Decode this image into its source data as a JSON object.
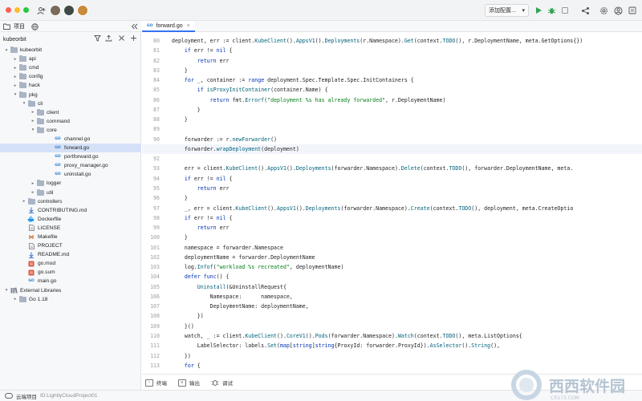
{
  "toolbar": {
    "run_config_label": "添加配置...",
    "run_config_caret": "▾",
    "icons": [
      "add-user-icon",
      "run-icon",
      "debug-icon",
      "stop-icon",
      "share-icon",
      "settings-icon",
      "account-icon"
    ]
  },
  "sidebar": {
    "tabs": [
      {
        "label": "项目",
        "icon": "project-icon"
      },
      {
        "label": "",
        "icon": "globe-icon"
      }
    ],
    "collapse_icon": "collapse-panel-icon",
    "project_label": "kubeorbit",
    "tools": [
      "filter-icon",
      "upload-icon",
      "close-icon",
      "add-icon"
    ],
    "tree": [
      {
        "label": "kubeorbit",
        "type": "folder",
        "depth": 0,
        "expanded": true
      },
      {
        "label": "api",
        "type": "folder",
        "depth": 1,
        "expanded": false
      },
      {
        "label": "cmd",
        "type": "folder",
        "depth": 1,
        "expanded": false
      },
      {
        "label": "config",
        "type": "folder",
        "depth": 1,
        "expanded": false
      },
      {
        "label": "hack",
        "type": "folder",
        "depth": 1,
        "expanded": false
      },
      {
        "label": "pkg",
        "type": "folder",
        "depth": 1,
        "expanded": true
      },
      {
        "label": "cli",
        "type": "folder",
        "depth": 2,
        "expanded": true
      },
      {
        "label": "client",
        "type": "folder",
        "depth": 3,
        "expanded": false
      },
      {
        "label": "command",
        "type": "folder",
        "depth": 3,
        "expanded": false
      },
      {
        "label": "core",
        "type": "folder",
        "depth": 3,
        "expanded": true
      },
      {
        "label": "channel.go",
        "type": "go",
        "depth": 5
      },
      {
        "label": "forward.go",
        "type": "go",
        "depth": 5,
        "selected": true
      },
      {
        "label": "portforward.go",
        "type": "go",
        "depth": 5
      },
      {
        "label": "proxy_manager.go",
        "type": "go",
        "depth": 5
      },
      {
        "label": "uninstall.go",
        "type": "go",
        "depth": 5
      },
      {
        "label": "logger",
        "type": "folder",
        "depth": 3,
        "expanded": false
      },
      {
        "label": "util",
        "type": "folder",
        "depth": 3,
        "expanded": false
      },
      {
        "label": "controllers",
        "type": "folder",
        "depth": 2,
        "expanded": false
      },
      {
        "label": "CONTRIBUTING.md",
        "type": "md",
        "depth": 2
      },
      {
        "label": "Dockerfile",
        "type": "docker",
        "depth": 2
      },
      {
        "label": "LICENSE",
        "type": "text",
        "depth": 2
      },
      {
        "label": "Makefile",
        "type": "make",
        "depth": 2
      },
      {
        "label": "PROJECT",
        "type": "text",
        "depth": 2
      },
      {
        "label": "README.md",
        "type": "md",
        "depth": 2
      },
      {
        "label": "go.mod",
        "type": "mod",
        "depth": 2
      },
      {
        "label": "go.sum",
        "type": "mod",
        "depth": 2
      },
      {
        "label": "main.go",
        "type": "go",
        "depth": 2
      },
      {
        "label": "External Libraries",
        "type": "lib",
        "depth": 0,
        "expanded": true
      },
      {
        "label": "Go 1.18",
        "type": "folder",
        "depth": 1,
        "expanded": false
      }
    ]
  },
  "editor": {
    "tab_label": "forward.go",
    "tab_close": "×",
    "current_line": 91,
    "lines": [
      {
        "n": 80,
        "parts": [
          [
            "",
            "deployment, err := client."
          ],
          [
            "fn",
            "KubeClient"
          ],
          [
            "",
            "()."
          ],
          [
            "fn",
            "AppsV1"
          ],
          [
            "",
            "()."
          ],
          [
            "fn",
            "Deployments"
          ],
          [
            "",
            "(r.Namespace)."
          ],
          [
            "fn",
            "Get"
          ],
          [
            "",
            "(context."
          ],
          [
            "fn",
            "TODO"
          ],
          [
            "",
            "(), r.DeploymentName, meta.GetOptions{})"
          ]
        ]
      },
      {
        "n": 81,
        "parts": [
          [
            "",
            "    "
          ],
          [
            "kw",
            "if"
          ],
          [
            "",
            " err != "
          ],
          [
            "kw",
            "nil"
          ],
          [
            "",
            " {"
          ]
        ]
      },
      {
        "n": 82,
        "parts": [
          [
            "",
            "        "
          ],
          [
            "kw",
            "return"
          ],
          [
            "",
            " err"
          ]
        ]
      },
      {
        "n": 83,
        "parts": [
          [
            "",
            "    }"
          ]
        ]
      },
      {
        "n": 84,
        "parts": [
          [
            "",
            "    "
          ],
          [
            "kw",
            "for"
          ],
          [
            "",
            " _, container := "
          ],
          [
            "kw",
            "range"
          ],
          [
            "",
            " deployment.Spec.Template.Spec.InitContainers {"
          ]
        ]
      },
      {
        "n": 85,
        "parts": [
          [
            "",
            "        "
          ],
          [
            "kw",
            "if"
          ],
          [
            "",
            " "
          ],
          [
            "fn",
            "isProxyInitContainer"
          ],
          [
            "",
            "(container.Name) {"
          ]
        ]
      },
      {
        "n": 86,
        "parts": [
          [
            "",
            "            "
          ],
          [
            "kw",
            "return"
          ],
          [
            "",
            " fmt."
          ],
          [
            "fn",
            "Errorf"
          ],
          [
            "",
            "("
          ],
          [
            "str",
            "\"deployment %s has already forwarded\""
          ],
          [
            "",
            ", r.DeploymentName)"
          ]
        ]
      },
      {
        "n": 87,
        "parts": [
          [
            "",
            "        }"
          ]
        ]
      },
      {
        "n": 88,
        "parts": [
          [
            "",
            "    }"
          ]
        ]
      },
      {
        "n": 89,
        "parts": [
          [
            "",
            ""
          ]
        ]
      },
      {
        "n": 90,
        "parts": [
          [
            "",
            "    forwarder := r."
          ],
          [
            "fn",
            "newForwarder"
          ],
          [
            "",
            "()"
          ]
        ]
      },
      {
        "n": 91,
        "parts": [
          [
            "",
            "    forwarder."
          ],
          [
            "fn",
            "wrapDeployment"
          ],
          [
            "",
            "(deployment)"
          ]
        ]
      },
      {
        "n": 92,
        "parts": [
          [
            "",
            ""
          ]
        ]
      },
      {
        "n": 93,
        "parts": [
          [
            "",
            "    err = client."
          ],
          [
            "fn",
            "KubeClient"
          ],
          [
            "",
            "()."
          ],
          [
            "fn",
            "AppsV1"
          ],
          [
            "",
            "()."
          ],
          [
            "fn",
            "Deployments"
          ],
          [
            "",
            "(forwarder.Namespace)."
          ],
          [
            "fn",
            "Delete"
          ],
          [
            "",
            "(context."
          ],
          [
            "fn",
            "TODO"
          ],
          [
            "",
            "(), forwarder.DeploymentName, meta."
          ]
        ]
      },
      {
        "n": 94,
        "parts": [
          [
            "",
            "    "
          ],
          [
            "kw",
            "if"
          ],
          [
            "",
            " err != "
          ],
          [
            "kw",
            "nil"
          ],
          [
            "",
            " {"
          ]
        ]
      },
      {
        "n": 95,
        "parts": [
          [
            "",
            "        "
          ],
          [
            "kw",
            "return"
          ],
          [
            "",
            " err"
          ]
        ]
      },
      {
        "n": 96,
        "parts": [
          [
            "",
            "    }"
          ]
        ]
      },
      {
        "n": 97,
        "parts": [
          [
            "",
            "    _, err = client."
          ],
          [
            "fn",
            "KubeClient"
          ],
          [
            "",
            "()."
          ],
          [
            "fn",
            "AppsV1"
          ],
          [
            "",
            "()."
          ],
          [
            "fn",
            "Deployments"
          ],
          [
            "",
            "(forwarder.Namespace)."
          ],
          [
            "fn",
            "Create"
          ],
          [
            "",
            "(context."
          ],
          [
            "fn",
            "TODO"
          ],
          [
            "",
            "(), deployment, meta.CreateOptio"
          ]
        ]
      },
      {
        "n": 98,
        "parts": [
          [
            "",
            "    "
          ],
          [
            "kw",
            "if"
          ],
          [
            "",
            " err != "
          ],
          [
            "kw",
            "nil"
          ],
          [
            "",
            " {"
          ]
        ]
      },
      {
        "n": 99,
        "parts": [
          [
            "",
            "        "
          ],
          [
            "kw",
            "return"
          ],
          [
            "",
            " err"
          ]
        ]
      },
      {
        "n": 100,
        "parts": [
          [
            "",
            "    }"
          ]
        ]
      },
      {
        "n": 101,
        "parts": [
          [
            "",
            "    namespace = forwarder.Namespace"
          ]
        ]
      },
      {
        "n": 102,
        "parts": [
          [
            "",
            "    deploymentName = forwarder.DeploymentName"
          ]
        ]
      },
      {
        "n": 103,
        "parts": [
          [
            "",
            "    log."
          ],
          [
            "fn",
            "Infof"
          ],
          [
            "",
            "("
          ],
          [
            "str",
            "\"workload %s recreated\""
          ],
          [
            "",
            ", deploymentName)"
          ]
        ]
      },
      {
        "n": 104,
        "parts": [
          [
            "",
            "    "
          ],
          [
            "kw",
            "defer"
          ],
          [
            "",
            " "
          ],
          [
            "kw",
            "func"
          ],
          [
            "",
            "() {"
          ]
        ]
      },
      {
        "n": 105,
        "parts": [
          [
            "",
            "        "
          ],
          [
            "fn",
            "Uninstall"
          ],
          [
            "",
            "(&UninstallRequest{"
          ]
        ]
      },
      {
        "n": 106,
        "parts": [
          [
            "",
            "            Namespace:      namespace,"
          ]
        ]
      },
      {
        "n": 107,
        "parts": [
          [
            "",
            "            DeploymentName: deploymentName,"
          ]
        ]
      },
      {
        "n": 108,
        "parts": [
          [
            "",
            "        })"
          ]
        ]
      },
      {
        "n": 109,
        "parts": [
          [
            "",
            "    }()"
          ]
        ]
      },
      {
        "n": 110,
        "parts": [
          [
            "",
            "    watch, _ := client."
          ],
          [
            "fn",
            "KubeClient"
          ],
          [
            "",
            "()."
          ],
          [
            "fn",
            "CoreV1"
          ],
          [
            "",
            "()."
          ],
          [
            "fn",
            "Pods"
          ],
          [
            "",
            "(forwarder.Namespace)."
          ],
          [
            "fn",
            "Watch"
          ],
          [
            "",
            "(context."
          ],
          [
            "fn",
            "TODO"
          ],
          [
            "",
            "(), meta.ListOptions{"
          ]
        ]
      },
      {
        "n": 111,
        "parts": [
          [
            "",
            "        LabelSelector: labels."
          ],
          [
            "fn",
            "Set"
          ],
          [
            "",
            "("
          ],
          [
            "kw",
            "map"
          ],
          [
            "",
            "["
          ],
          [
            "kw",
            "string"
          ],
          [
            "",
            "]"
          ],
          [
            "kw",
            "string"
          ],
          [
            "",
            "{ProxyId: forwarder.ProxyId})."
          ],
          [
            "fn",
            "AsSelector"
          ],
          [
            "",
            "()."
          ],
          [
            "fn",
            "String"
          ],
          [
            "",
            "(),"
          ]
        ]
      },
      {
        "n": 112,
        "parts": [
          [
            "",
            "    })"
          ]
        ]
      },
      {
        "n": 113,
        "parts": [
          [
            "",
            "    "
          ],
          [
            "kw",
            "for"
          ],
          [
            "",
            " {"
          ]
        ]
      }
    ]
  },
  "bottom_tools": [
    {
      "label": "终端",
      "icon": "terminal-icon"
    },
    {
      "label": "输出",
      "icon": "output-icon"
    },
    {
      "label": "调试",
      "icon": "debug-bug-icon"
    }
  ],
  "status": {
    "label": "云端项目",
    "id": "ID:LightlyCloudProject01",
    "icon": "cloud-icon"
  },
  "watermark": {
    "text": "西西软件园",
    "sub": "CR173.COM"
  }
}
